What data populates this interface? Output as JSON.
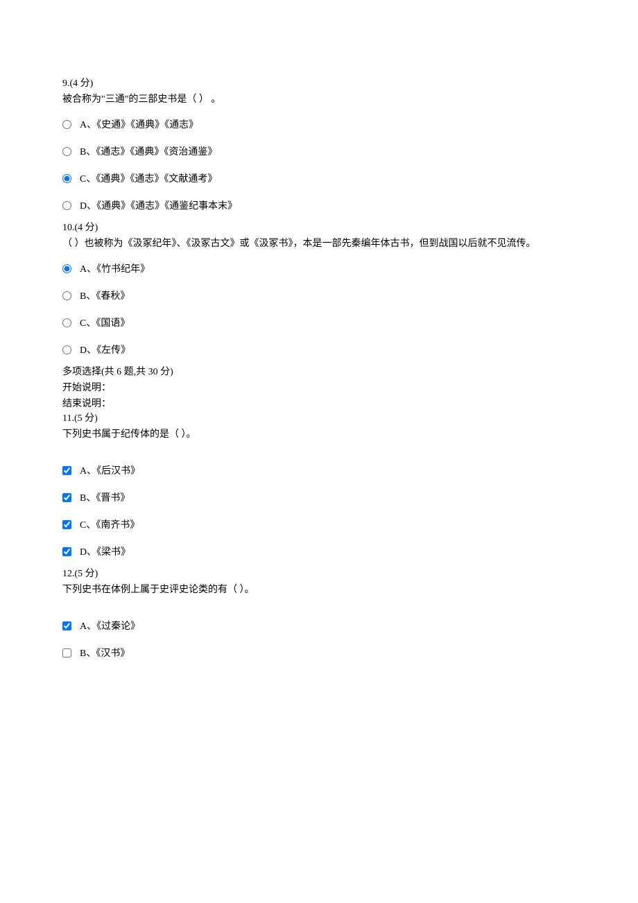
{
  "q9": {
    "header": "9.(4 分)",
    "stem": "被合称为\"三通\"的三部史书是（  ） 。",
    "options": [
      "A、《史通》《通典》《通志》",
      "B、《通志》《通典》《资治通鉴》",
      "C、《通典》《通志》《文献通考》",
      "D、《通典》《通志》《通鉴纪事本末》"
    ]
  },
  "q10": {
    "header": "10.(4 分)",
    "stem": "（  ）也被称为《汲冢纪年》、《汲冢古文》或《汲冢书》，本是一部先秦编年体古书，但到战国以后就不见流传。",
    "options": [
      "A、《竹书纪年》",
      "B、《春秋》",
      "C、《国语》",
      "D、《左传》"
    ]
  },
  "section": {
    "title": "多项选择(共 6 题,共 30 分)",
    "start": "开始说明：",
    "end": "结束说明："
  },
  "q11": {
    "header": "11.(5 分)",
    "stem": "下列史书属于纪传体的是（  ）。",
    "options": [
      "A、《后汉书》",
      "B、《晋书》",
      "C、《南齐书》",
      "D、《梁书》"
    ]
  },
  "q12": {
    "header": "12.(5 分)",
    "stem": "下列史书在体例上属于史评史论类的有（  ）。",
    "options": [
      "A、《过秦论》",
      "B、《汉书》"
    ]
  }
}
